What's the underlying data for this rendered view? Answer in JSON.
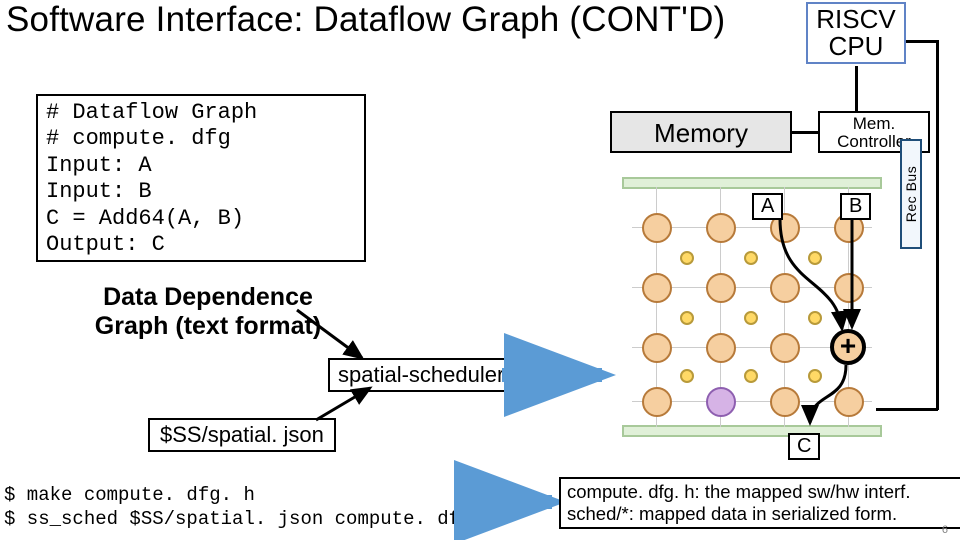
{
  "title": "Software Interface: Dataflow Graph (CONT'D)",
  "riscv": {
    "line1": "RISCV",
    "line2": "CPU"
  },
  "dfg_text": "# Dataflow Graph\n# compute. dfg\nInput: A\nInput: B\nC = Add64(A, B)\nOutput: C",
  "ddg_caption": "Data Dependence\nGraph (text format)",
  "scheduler_label": "spatial-scheduler",
  "json_label": "$SS/spatial. json",
  "terminal": "$ make compute. dfg. h\n$ ss_sched $SS/spatial. json compute. dfg",
  "result": {
    "line1": "compute. dfg. h: the mapped sw/hw interf.",
    "line2": "sched/*: mapped data in serialized form."
  },
  "hw": {
    "memory": "Memory",
    "memctl_l1": "Mem.",
    "memctl_l2": "Controller",
    "rec_bus": "Rec Bus",
    "A": "A",
    "B": "B",
    "C": "C",
    "plus": "+"
  },
  "page_number": "6"
}
